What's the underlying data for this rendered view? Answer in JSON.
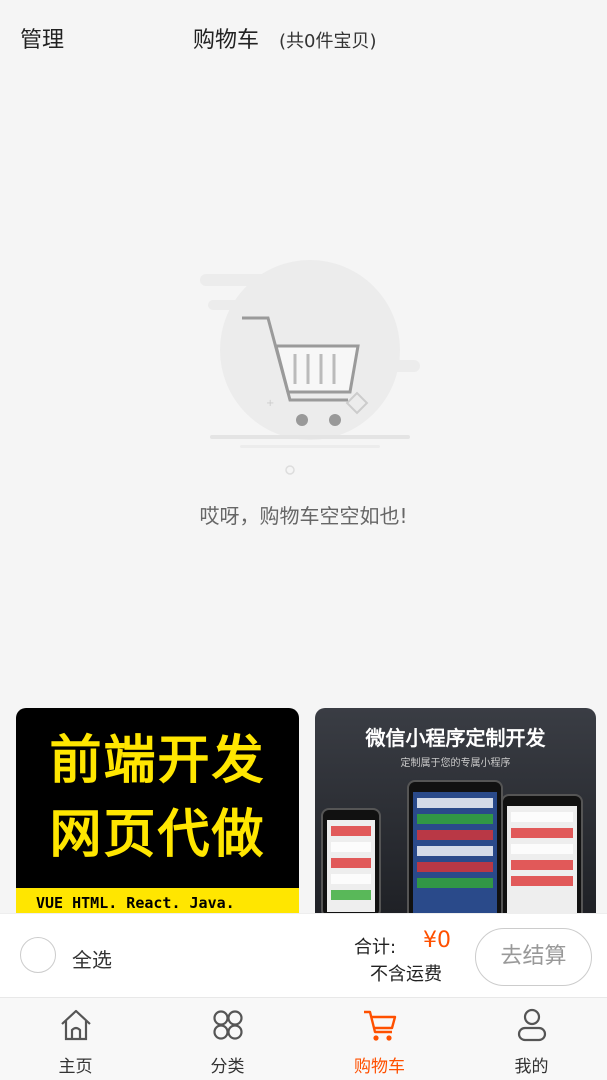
{
  "header": {
    "manage_label": "管理",
    "title": "购物车",
    "count_text": "(共0件宝贝)"
  },
  "empty_state": {
    "icon": "empty-cart-icon",
    "message": "哎呀，购物车空空如也!"
  },
  "banners": [
    {
      "line1": "前端开发",
      "line2": "网页代做",
      "strip": "VUE  HTML. React. Java."
    },
    {
      "title": "微信小程序定制开发",
      "subtitle": "定制属于您的专属小程序"
    }
  ],
  "checkout_bar": {
    "select_all_label": "全选",
    "total_label": "合计:",
    "total_value": "¥0",
    "shipping_note": "不含运费",
    "checkout_button": "去结算"
  },
  "tabbar": {
    "items": [
      {
        "label": "主页",
        "icon": "home-icon",
        "active": false
      },
      {
        "label": "分类",
        "icon": "category-icon",
        "active": false
      },
      {
        "label": "购物车",
        "icon": "cart-icon",
        "active": true
      },
      {
        "label": "我的",
        "icon": "profile-icon",
        "active": false
      }
    ]
  },
  "colors": {
    "accent": "#ff5000",
    "banner_yellow": "#ffe600",
    "background": "#f5f5f5"
  }
}
